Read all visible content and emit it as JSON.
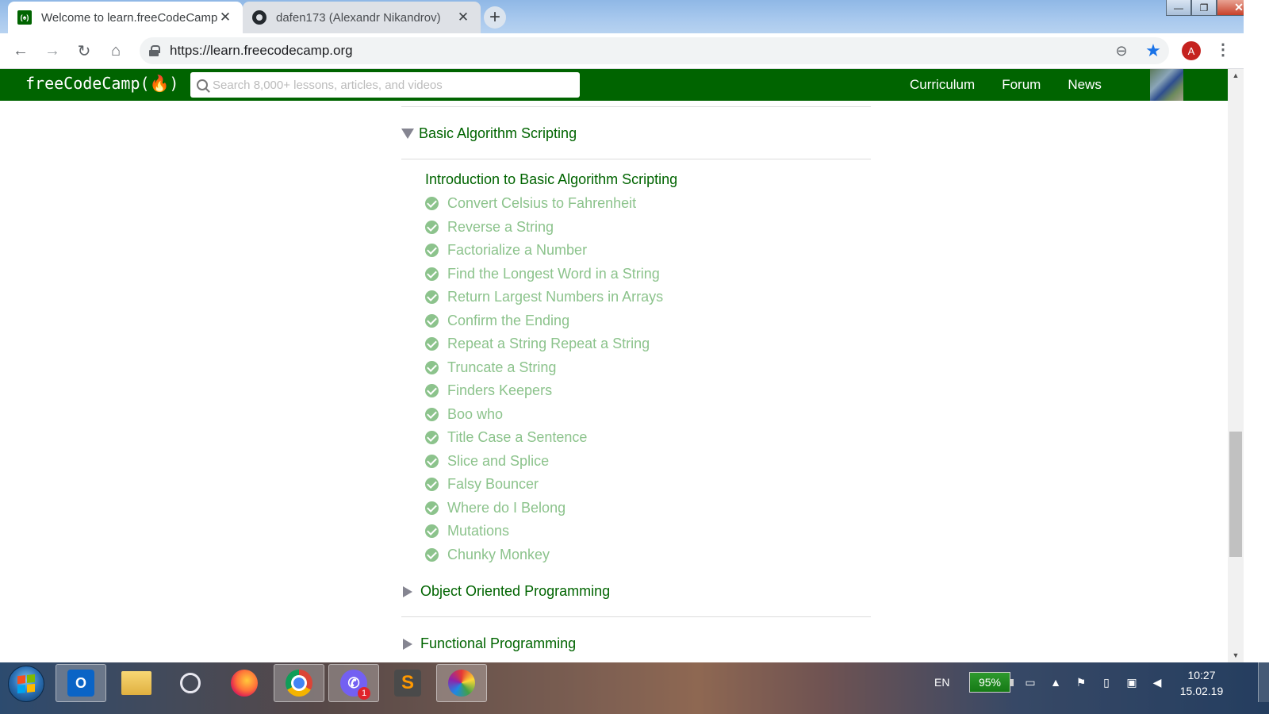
{
  "browser": {
    "tabs": [
      {
        "title": "Welcome to learn.freeCodeCamp",
        "favicon": "freecodecamp-icon",
        "active": true
      },
      {
        "title": "dafen173 (Alexandr Nikandrov)",
        "favicon": "github-icon",
        "active": false
      }
    ],
    "new_tab_label": "+",
    "url": "https://learn.freecodecamp.org",
    "profile_initial": "A"
  },
  "fcc": {
    "logo_text": "freeCodeCamp(🔥)",
    "search_placeholder": "Search 8,000+ lessons, articles, and videos",
    "nav_links": [
      "Curriculum",
      "Forum",
      "News"
    ]
  },
  "curriculum": {
    "expanded_block": "Basic Algorithm Scripting",
    "intro": "Introduction to Basic Algorithm Scripting",
    "challenges": [
      "Convert Celsius to Fahrenheit",
      "Reverse a String",
      "Factorialize a Number",
      "Find the Longest Word in a String",
      "Return Largest Numbers in Arrays",
      "Confirm the Ending",
      "Repeat a String Repeat a String",
      "Truncate a String",
      "Finders Keepers",
      "Boo who",
      "Title Case a Sentence",
      "Slice and Splice",
      "Falsy Bouncer",
      "Where do I Belong",
      "Mutations",
      "Chunky Monkey"
    ],
    "collapsed_blocks": [
      "Object Oriented Programming",
      "Functional Programming"
    ]
  },
  "taskbar": {
    "language": "EN",
    "battery": "95%",
    "viber_badge": "1",
    "time": "10:27",
    "date": "15.02.19"
  },
  "colors": {
    "fcc_green": "#006400",
    "completed_green": "#8cc38c",
    "chrome_blue": "#1a73e8"
  }
}
